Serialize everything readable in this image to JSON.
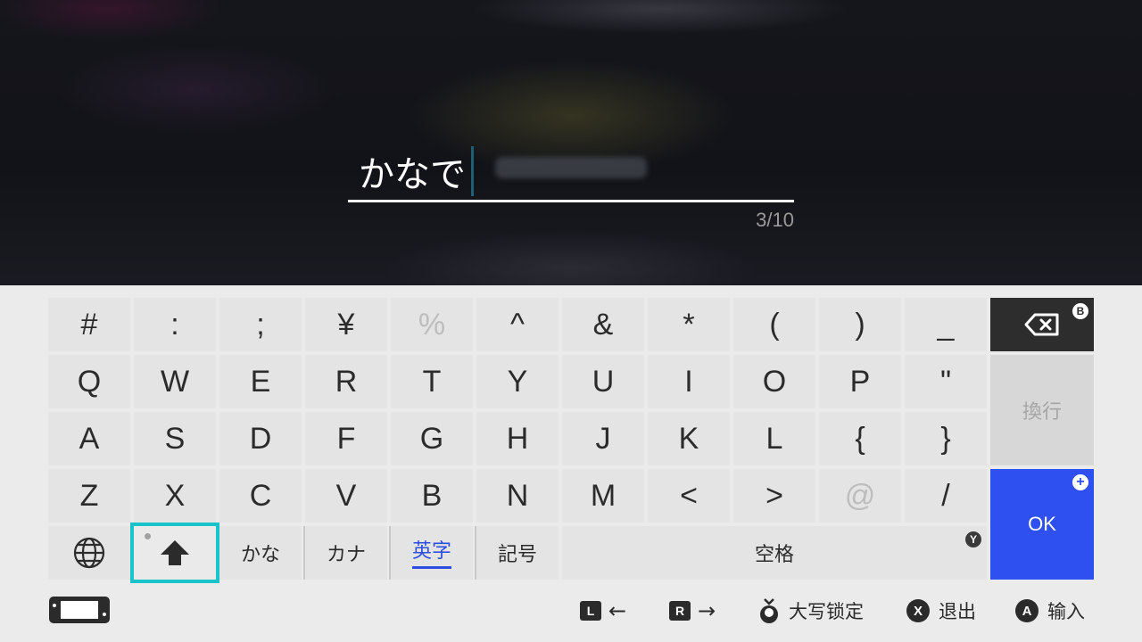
{
  "input": {
    "value": "かなで",
    "counter": "3/10"
  },
  "keyboard": {
    "rows": [
      [
        "#",
        ":",
        ";",
        "¥",
        "%",
        "^",
        "&",
        "*",
        "(",
        ")",
        "_"
      ],
      [
        "Q",
        "W",
        "E",
        "R",
        "T",
        "Y",
        "U",
        "I",
        "O",
        "P",
        "\""
      ],
      [
        "A",
        "S",
        "D",
        "F",
        "G",
        "H",
        "J",
        "K",
        "L",
        "{",
        "}"
      ],
      [
        "Z",
        "X",
        "C",
        "V",
        "B",
        "N",
        "M",
        "<",
        ">",
        "@",
        "/"
      ]
    ],
    "disabled_keys": [
      "%",
      "@"
    ],
    "modes": {
      "kana": "かな",
      "katakana": "カナ",
      "english": "英字",
      "symbols": "記号"
    },
    "active_mode": "英字",
    "space_label": "空格",
    "space_badge": "Y",
    "backspace_badge": "B",
    "enter_label": "換行",
    "ok_label": "OK",
    "ok_badge": "+"
  },
  "hints": {
    "l_button": "L",
    "l_arrow": "←",
    "r_button": "R",
    "r_arrow": "→",
    "caps_lock": "大写锁定",
    "x_button": "X",
    "exit": "退出",
    "a_button": "A",
    "input": "输入"
  },
  "colors": {
    "accent_ok": "#2f50f0",
    "active_mode": "#2f4fe0",
    "focus_outline": "#19c3c9",
    "backspace_bg": "#2d2d2d"
  },
  "icons": {
    "globe": "globe-icon",
    "shift": "shift-arrow-icon",
    "backspace": "backspace-icon",
    "console": "console-handheld-icon",
    "stick": "stick-press-icon"
  }
}
